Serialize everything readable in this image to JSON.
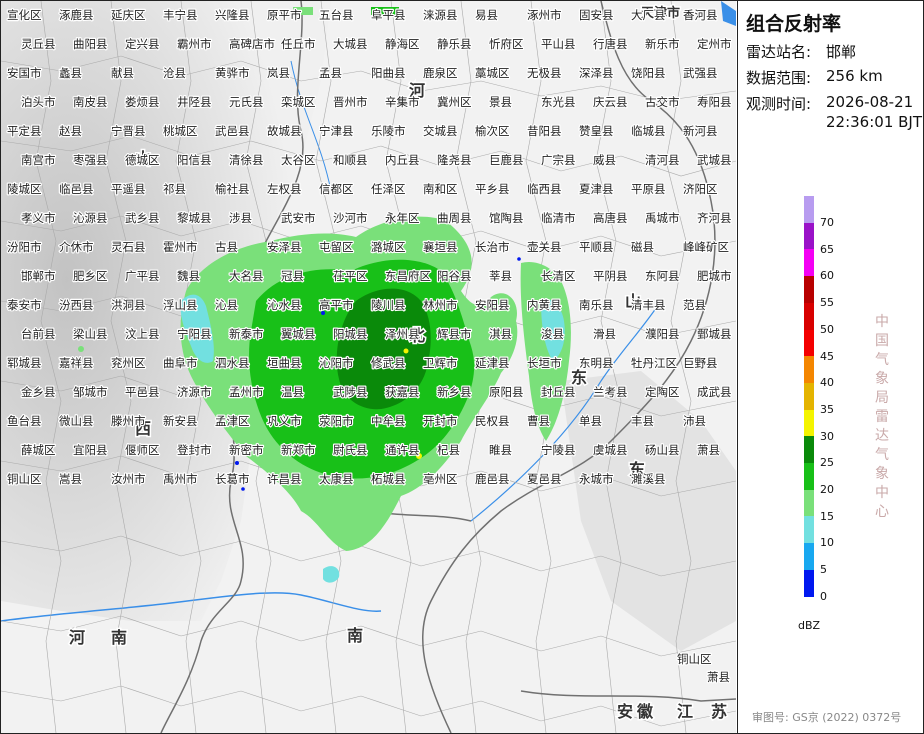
{
  "panel": {
    "title": "组合反射率",
    "station_label": "雷达站名:",
    "station_value": "邯郸",
    "range_label": "数据范围:",
    "range_value": "256 km",
    "time_label": "观测时间:",
    "time_date": "2026-08-21",
    "time_clock": "22:36:01 BJT",
    "vertical_text": "中国气象局雷达气象中心",
    "unit": "dBZ",
    "approval": "审图号: GS京 (2022) 0372号"
  },
  "legend": [
    {
      "value": "70",
      "color": "#b89cf0"
    },
    {
      "value": "65",
      "color": "#9a12c8"
    },
    {
      "value": "60",
      "color": "#f400f4"
    },
    {
      "value": "55",
      "color": "#b80000"
    },
    {
      "value": "50",
      "color": "#d80000"
    },
    {
      "value": "45",
      "color": "#f40000"
    },
    {
      "value": "40",
      "color": "#f48600"
    },
    {
      "value": "35",
      "color": "#e4b400"
    },
    {
      "value": "30",
      "color": "#f4f400"
    },
    {
      "value": "25",
      "color": "#0a8a0a"
    },
    {
      "value": "20",
      "color": "#18c018"
    },
    {
      "value": "15",
      "color": "#7ae07a"
    },
    {
      "value": "10",
      "color": "#72e0e0"
    },
    {
      "value": "5",
      "color": "#18a8f0"
    },
    {
      "value": "0",
      "color": "#0018f0"
    }
  ],
  "province_labels": [
    "山",
    "西",
    "河",
    "北",
    "南",
    "东",
    "山",
    "东",
    "河",
    "南",
    "江",
    "苏",
    "安",
    "徽",
    "天津市"
  ],
  "cities": [
    "宣化区",
    "涿鹿县",
    "延庆区",
    "丰宁县",
    "兴隆县",
    "原平市",
    "五台县",
    "阜平县",
    "涞源县",
    "易县",
    "涿州市",
    "固安县",
    "大厂县",
    "香河县",
    "灵丘县",
    "曲阳县",
    "定兴县",
    "霸州市",
    "高碑店市",
    "任丘市",
    "大城县",
    "静海区",
    "静乐县",
    "忻府区",
    "平山县",
    "行唐县",
    "新乐市",
    "定州市",
    "安国市",
    "蠡县",
    "献县",
    "沧县",
    "黄骅市",
    "岚县",
    "孟县",
    "阳曲县",
    "鹿泉区",
    "藁城区",
    "无极县",
    "深泽县",
    "饶阳县",
    "武强县",
    "泊头市",
    "南皮县",
    "娄烦县",
    "井陉县",
    "元氏县",
    "栾城区",
    "晋州市",
    "辛集市",
    "冀州区",
    "景县",
    "东光县",
    "庆云县",
    "古交市",
    "寿阳县",
    "平定县",
    "赵县",
    "宁晋县",
    "桃城区",
    "武邑县",
    "故城县",
    "宁津县",
    "乐陵市",
    "交城县",
    "榆次区",
    "昔阳县",
    "赞皇县",
    "临城县",
    "新河县",
    "南宫市",
    "枣强县",
    "德城区",
    "阳信县",
    "清徐县",
    "太谷区",
    "和顺县",
    "内丘县",
    "隆尧县",
    "巨鹿县",
    "广宗县",
    "威县",
    "清河县",
    "武城县",
    "陵城区",
    "临邑县",
    "平遥县",
    "祁县",
    "榆社县",
    "左权县",
    "信都区",
    "任泽区",
    "南和区",
    "平乡县",
    "临西县",
    "夏津县",
    "平原县",
    "济阳区",
    "孝义市",
    "沁源县",
    "武乡县",
    "黎城县",
    "涉县",
    "武安市",
    "沙河市",
    "永年区",
    "曲周县",
    "馆陶县",
    "临清市",
    "高唐县",
    "禹城市",
    "齐河县",
    "汾阳市",
    "介休市",
    "灵石县",
    "霍州市",
    "古县",
    "安泽县",
    "屯留区",
    "潞城区",
    "襄垣县",
    "长治市",
    "壶关县",
    "平顺县",
    "磁县",
    "峰峰矿区",
    "邯郸市",
    "肥乡区",
    "广平县",
    "魏县",
    "大名县",
    "冠县",
    "茌平区",
    "东昌府区",
    "阳谷县",
    "莘县",
    "长清区",
    "平阴县",
    "东阿县",
    "肥城市",
    "泰安市",
    "汾西县",
    "洪洞县",
    "浮山县",
    "沁县",
    "沁水县",
    "高平市",
    "陵川县",
    "林州市",
    "安阳县",
    "内黄县",
    "南乐县",
    "清丰县",
    "范县",
    "台前县",
    "梁山县",
    "汶上县",
    "宁阳县",
    "新泰市",
    "翼城县",
    "阳城县",
    "泽州县",
    "辉县市",
    "淇县",
    "浚县",
    "滑县",
    "濮阳县",
    "鄄城县",
    "郓城县",
    "嘉祥县",
    "兖州区",
    "曲阜市",
    "泗水县",
    "垣曲县",
    "沁阳市",
    "修武县",
    "卫辉市",
    "延津县",
    "长垣市",
    "东明县",
    "牡丹江区",
    "巨野县",
    "金乡县",
    "邹城市",
    "平邑县",
    "济源市",
    "孟州市",
    "温县",
    "武陟县",
    "获嘉县",
    "新乡县",
    "原阳县",
    "封丘县",
    "兰考县",
    "定陶区",
    "成武县",
    "鱼台县",
    "微山县",
    "滕州市",
    "新安县",
    "孟津区",
    "巩义市",
    "荥阳市",
    "中牟县",
    "开封市",
    "民权县",
    "曹县",
    "单县",
    "丰县",
    "沛县",
    "薛城区",
    "宜阳县",
    "偃师区",
    "登封市",
    "新密市",
    "新郑市",
    "尉氏县",
    "通许县",
    "杞县",
    "睢县",
    "宁陵县",
    "虞城县",
    "砀山县",
    "萧县",
    "铜山区",
    "嵩县",
    "汝州市",
    "禹州市",
    "长葛市",
    "许昌县",
    "太康县",
    "柘城县",
    "亳州区",
    "鹿邑县",
    "夏邑县",
    "永城市",
    "濉溪县"
  ],
  "map_overlay_text": [
    "铜山区",
    "萧县"
  ]
}
